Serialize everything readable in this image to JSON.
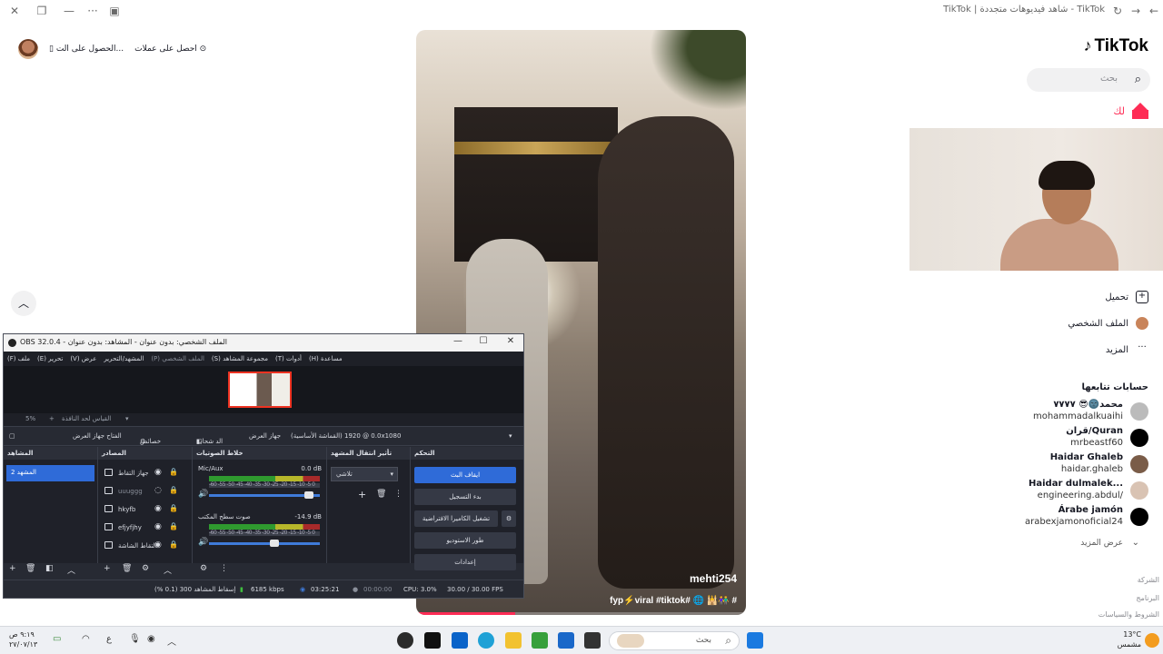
{
  "browser": {
    "tab_title": "TikTok | شاهد فيديوهات متجددة - TikTok"
  },
  "tiktok": {
    "logo_text": "TikTok",
    "search_placeholder": "بحث",
    "nav": {
      "home_label": "لك",
      "upload_label": "تحميل",
      "profile_label": "الملف الشخصي",
      "more_label": "المزيد"
    },
    "top_actions": {
      "get_coins": "احصل على عملات",
      "get_app": "الحصول على الت..."
    },
    "following_title": "حسابات تتابعها",
    "following": [
      {
        "name": "محمد🌚😎 ٧٧٧٧",
        "handle": "mohammadalkuaihi"
      },
      {
        "name": "قران/Quran",
        "handle": "mrbeastf60"
      },
      {
        "name": "Haidar Ghaleb",
        "handle": "haidar.ghaleb"
      },
      {
        "name": "Haidar dulmalek...",
        "handle": "engineering.abdul/"
      },
      {
        "name": "Árabe jamón",
        "handle": "arabexjamonoficial24"
      }
    ],
    "see_more": "عرض المزيد",
    "footer_links": [
      "الشركة",
      "البرنامج",
      "الشروط والسياسات"
    ],
    "video": {
      "username": "mehti254",
      "caption": "fyp⚡viral #tiktok# 🌐 🕌👫 #",
      "progress": 0.3
    }
  },
  "obs": {
    "title": "OBS 32.0.4 - الملف الشخصي: بدون عنوان - المشاهد: بدون عنوان",
    "menu": [
      "(F) ملف",
      "(E) تحرير",
      "(V) عرض",
      "المشهد/التحرير",
      "(P) الملف الشخصي",
      "(S) مجموعة المشاهد",
      "(T) أدوات",
      "(H) مساعدة"
    ],
    "zoom": {
      "percent": "5%",
      "label": "القياس لحد النافذة"
    },
    "toolbar": {
      "canvas": "(القماشة الأساسية) 0.0 @ 1920x1080",
      "display": "جهاز العرض",
      "filters": "الد شحات",
      "properties": "خصائص",
      "open_display": "الفتاح جهاز العرض"
    },
    "docks": {
      "scenes": "المشاهد",
      "sources": "المصادر",
      "mixer": "خلاط الصوتيات",
      "transitions": "تأثير انتقال المشهد",
      "controls": "التحكم"
    },
    "scenes": [
      "المشهد 2"
    ],
    "sources": [
      "جهاز التقاط",
      "uuuggg",
      "hkyfb",
      "efjyfjhy",
      "التقاط الشاشة"
    ],
    "mixer": [
      {
        "name": "Mic/Aux",
        "db": "0.0 dB",
        "level": 0.94
      },
      {
        "name": "صوت سطح المكتب",
        "db": "-14.9 dB",
        "level": 0.6
      }
    ],
    "mixer_scale": "-60 -55 -50 -45 -40 -35 -30 -25 -20 -15 -10 -5 0",
    "transition": "تلاشي",
    "controls": [
      "ايقاف البث",
      "بدء التسجيل",
      "تشغيل الكاميرا الافتراضية",
      "طور الاستوديو",
      "إعدادات"
    ],
    "status": {
      "dropped": "إسقاط المشاهد 300 (0.1 %)",
      "bitrate": "6185 kbps",
      "stream_time": "03:25:21",
      "rec_time": "00:00:00",
      "cpu": "CPU: 3.0%",
      "fps": "30.00 / 30.00 FPS"
    }
  },
  "taskbar": {
    "time": "٩:١٩ ص",
    "date": "٢٧/٠٧/١٣",
    "search_placeholder": "بحث",
    "weather_temp": "13°C",
    "weather_desc": "مشمس",
    "lang": "ع"
  },
  "colors": {
    "tiktok_red": "#fe2c55",
    "obs_accent": "#2f6bd8",
    "obs_bg": "#272a33"
  }
}
